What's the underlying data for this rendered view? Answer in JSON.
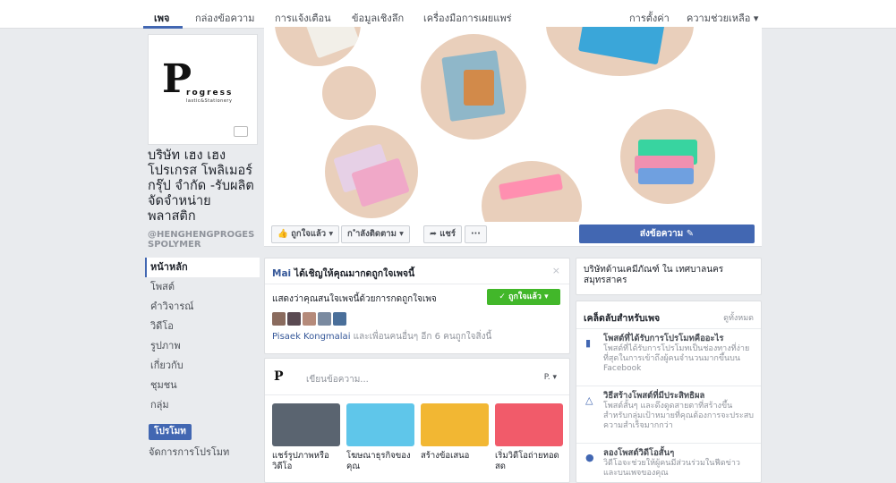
{
  "topnav": {
    "items": [
      "เพจ",
      "กล่องข้อความ",
      "การแจ้งเตือน",
      "ข้อมูลเชิงลึก",
      "เครื่องมือการเผยแพร่"
    ],
    "settings": "การตั้งค่า",
    "help": "ความช่วยเหลือ ▾"
  },
  "logo": {
    "word": "rogress",
    "sub": "lastic&Stationery"
  },
  "page": {
    "name": "บริษัท เฮง เฮง โปรเกรส โพลิเมอร์ กรุ๊ป จำกัด -รับผลิต จัดจำหน่าย พลาสติก",
    "handle": "@HENGHENGPROGESSPOLYMER"
  },
  "left_nav": [
    "หน้าหลัก",
    "โพสต์",
    "คำวิจารณ์",
    "วิดีโอ",
    "รูปภาพ",
    "เกี่ยวกับ",
    "ชุมชน",
    "กลุ่ม"
  ],
  "promote": {
    "button": "โปรโมท",
    "manage": "จัดการการโปรโมท"
  },
  "actions": {
    "liked": "👍 ถูกใจแล้ว ▾",
    "following": "ก ำลังติดตาม ▾",
    "share": "➦ แชร์",
    "more": "···",
    "send_message": "ส่งข้อความ ✎"
  },
  "invite": {
    "title_name": "Mai",
    "title_rest": " ได้เชิญให้คุณมากดถูกใจเพจนี้",
    "close": "×",
    "desc": "แสดงว่าคุณสนใจเพจนี้ด้วยการกดถูกใจเพจ",
    "like_button": "✓ ถูกใจแล้ว ▾",
    "friend_name": "Pisaek Kongmalai",
    "friend_rest": " และเพื่อนคนอื่นๆ อีก 6 คนถูกใจสิ่งนี้"
  },
  "composer": {
    "placeholder": "เขียนข้อความ...",
    "selector": "P. ▾",
    "tiles": [
      "แชร์รูปภาพหรือวิดีโอ",
      "โฆษณาธุรกิจของคุณ",
      "สร้างข้อเสนอ",
      "เริ่มวิดีโอถ่ายทอดสด"
    ]
  },
  "right": {
    "location": "บริษัทด้านเคมีภัณฑ์ ใน เทศบาลนครสมุทรสาคร",
    "tips_head": "เคล็ดลับสำหรับเพจ",
    "see_all": "ดูทั้งหมด",
    "tips": [
      {
        "title": "โพสต์ที่ได้รับการโปรโมทคืออะไร",
        "desc": "โพสต์ที่ได้รับการโปรโมทเป็นช่องทางที่ง่ายที่สุดในการเข้าถึงผู้คนจำนวนมากขึ้นบน Facebook"
      },
      {
        "title": "วิธีสร้างโพสต์ที่มีประสิทธิผล",
        "desc": "โพสต์สั้นๆ และดึงดูดสายตาที่สร้างขึ้นสำหรับกลุ่มเป้าหมายที่คุณต้องการจะประสบความสำเร็จมากกว่า"
      },
      {
        "title": "ลองโพสต์วิดีโอสั้นๆ",
        "desc": "วิดีโอจะช่วยให้ผู้คนมีส่วนร่วมในฟีดข่าวและบนเพจของคุณ"
      }
    ]
  },
  "colors": {
    "fb_blue": "#4267b2",
    "like_green": "#42b72a",
    "cover_circle": "#e9cfbb"
  }
}
